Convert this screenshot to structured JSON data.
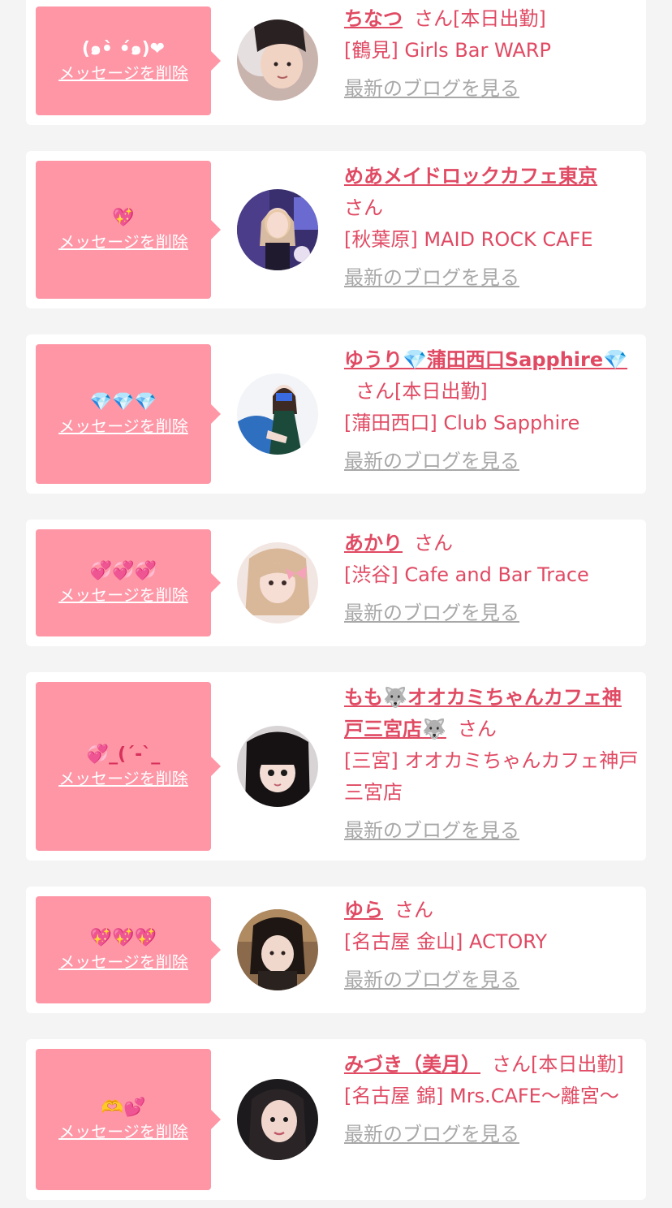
{
  "colors": {
    "page_bg": "#f4f4f4",
    "card_bg": "#ffffff",
    "message_bg": "#fe96a6",
    "accent_text": "#e04a63",
    "muted_link": "#a8a8a8"
  },
  "common": {
    "delete_label": "メッセージを削除",
    "blog_label": "最新のブログを見る"
  },
  "entries": [
    {
      "message": "(๑•̀ •́๑)❤",
      "name": "ちなつ",
      "san": "さん",
      "status": "[本日出勤]",
      "shop": "[鶴見] Girls Bar WARP"
    },
    {
      "message": "💖",
      "name": "めあメイドロックカフェ東京",
      "san": "さん",
      "status": "",
      "shop": "[秋葉原] MAID ROCK CAFE"
    },
    {
      "message": "💎💎💎",
      "name": "ゆうり💎蒲田西口Sapphire💎",
      "san": "さん",
      "status": "[本日出勤]",
      "shop": "[蒲田西口] Club Sapphire"
    },
    {
      "message": "💞💞💞",
      "name": "あかり",
      "san": "さん",
      "status": "",
      "shop": "[渋谷] Cafe and Bar Trace"
    },
    {
      "message": "💞_(´-`_",
      "name": "もも🐺オオカミちゃんカフェ神戸三宮店🐺",
      "san": "さん",
      "status": "",
      "shop": "[三宮] オオカミちゃんカフェ神戸三宮店"
    },
    {
      "message": "💖💖💖",
      "name": "ゆら",
      "san": "さん",
      "status": "",
      "shop": "[名古屋 金山] ACTORY"
    },
    {
      "message": "🫶💕",
      "name": "みづき（美月）",
      "san": "さん",
      "status": "[本日出勤]",
      "shop": "[名古屋 錦] Mrs.CAFE〜離宮〜"
    }
  ]
}
